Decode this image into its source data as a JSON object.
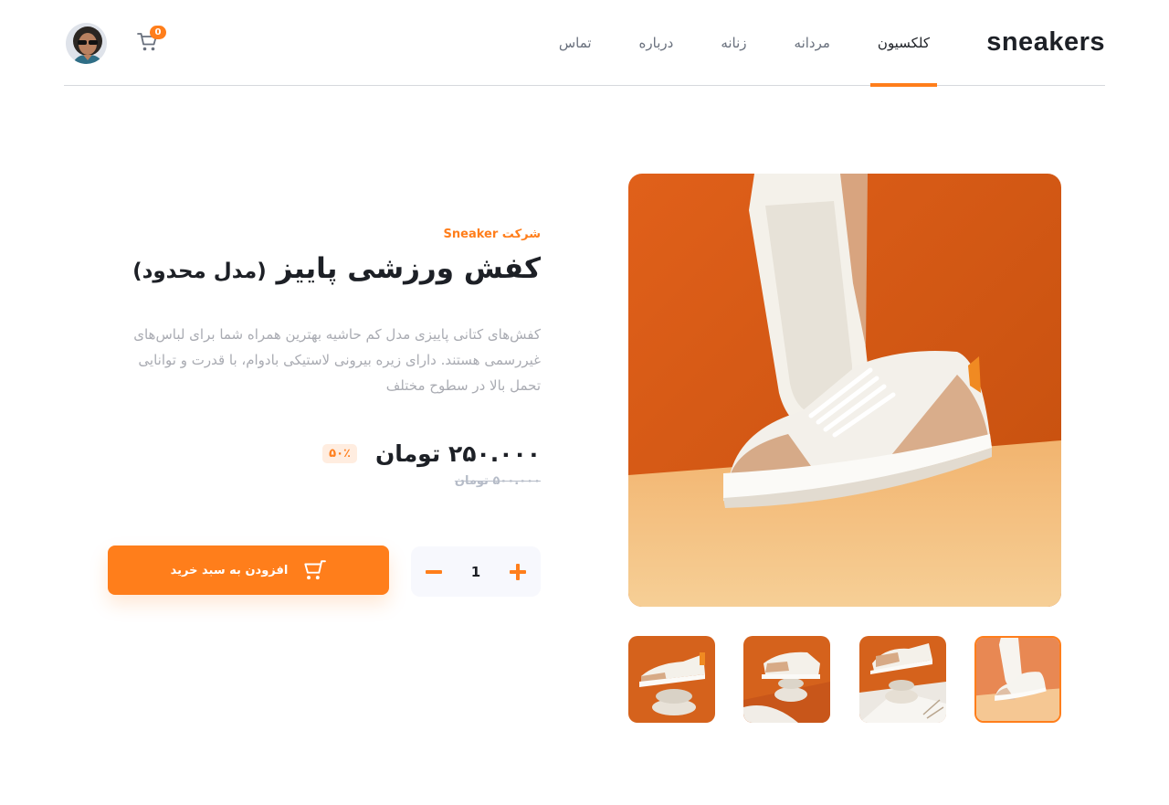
{
  "header": {
    "logo": "sneakers",
    "nav": [
      {
        "label": "کلکسیون",
        "active": true
      },
      {
        "label": "مردانه",
        "active": false
      },
      {
        "label": "زنانه",
        "active": false
      },
      {
        "label": "درباره",
        "active": false
      },
      {
        "label": "تماس",
        "active": false
      }
    ],
    "cart_count": "0",
    "icons": {
      "cart": "cart-icon",
      "avatar": "user-avatar"
    }
  },
  "product": {
    "company": "شرکت Sneaker",
    "title": "کفش ورزشی پاییز",
    "title_suffix": "(مدل محدود)",
    "description": "کفش‌های کتانی پاییزی مدل کم حاشیه بهترین همراه شما برای لباس‌های غیررسمی هستند. دارای زیره بیرونی لاستیکی بادوام، با قدرت و توانایی تحمل بالا در سطوح مختلف",
    "price": "۲۵۰.۰۰۰ تومان",
    "discount": "۵۰٪",
    "old_price": "۵۰۰.۰۰۰ تومان"
  },
  "cart_controls": {
    "quantity": "1",
    "add_label": "افزودن به سبد خرید"
  },
  "gallery": {
    "thumbnail_count": 4,
    "active_thumbnail": 1
  },
  "colors": {
    "accent": "#ff7e1b",
    "accent_pale": "#ffede0",
    "text_dark": "#1d2026",
    "text_muted": "#a9abb2"
  }
}
